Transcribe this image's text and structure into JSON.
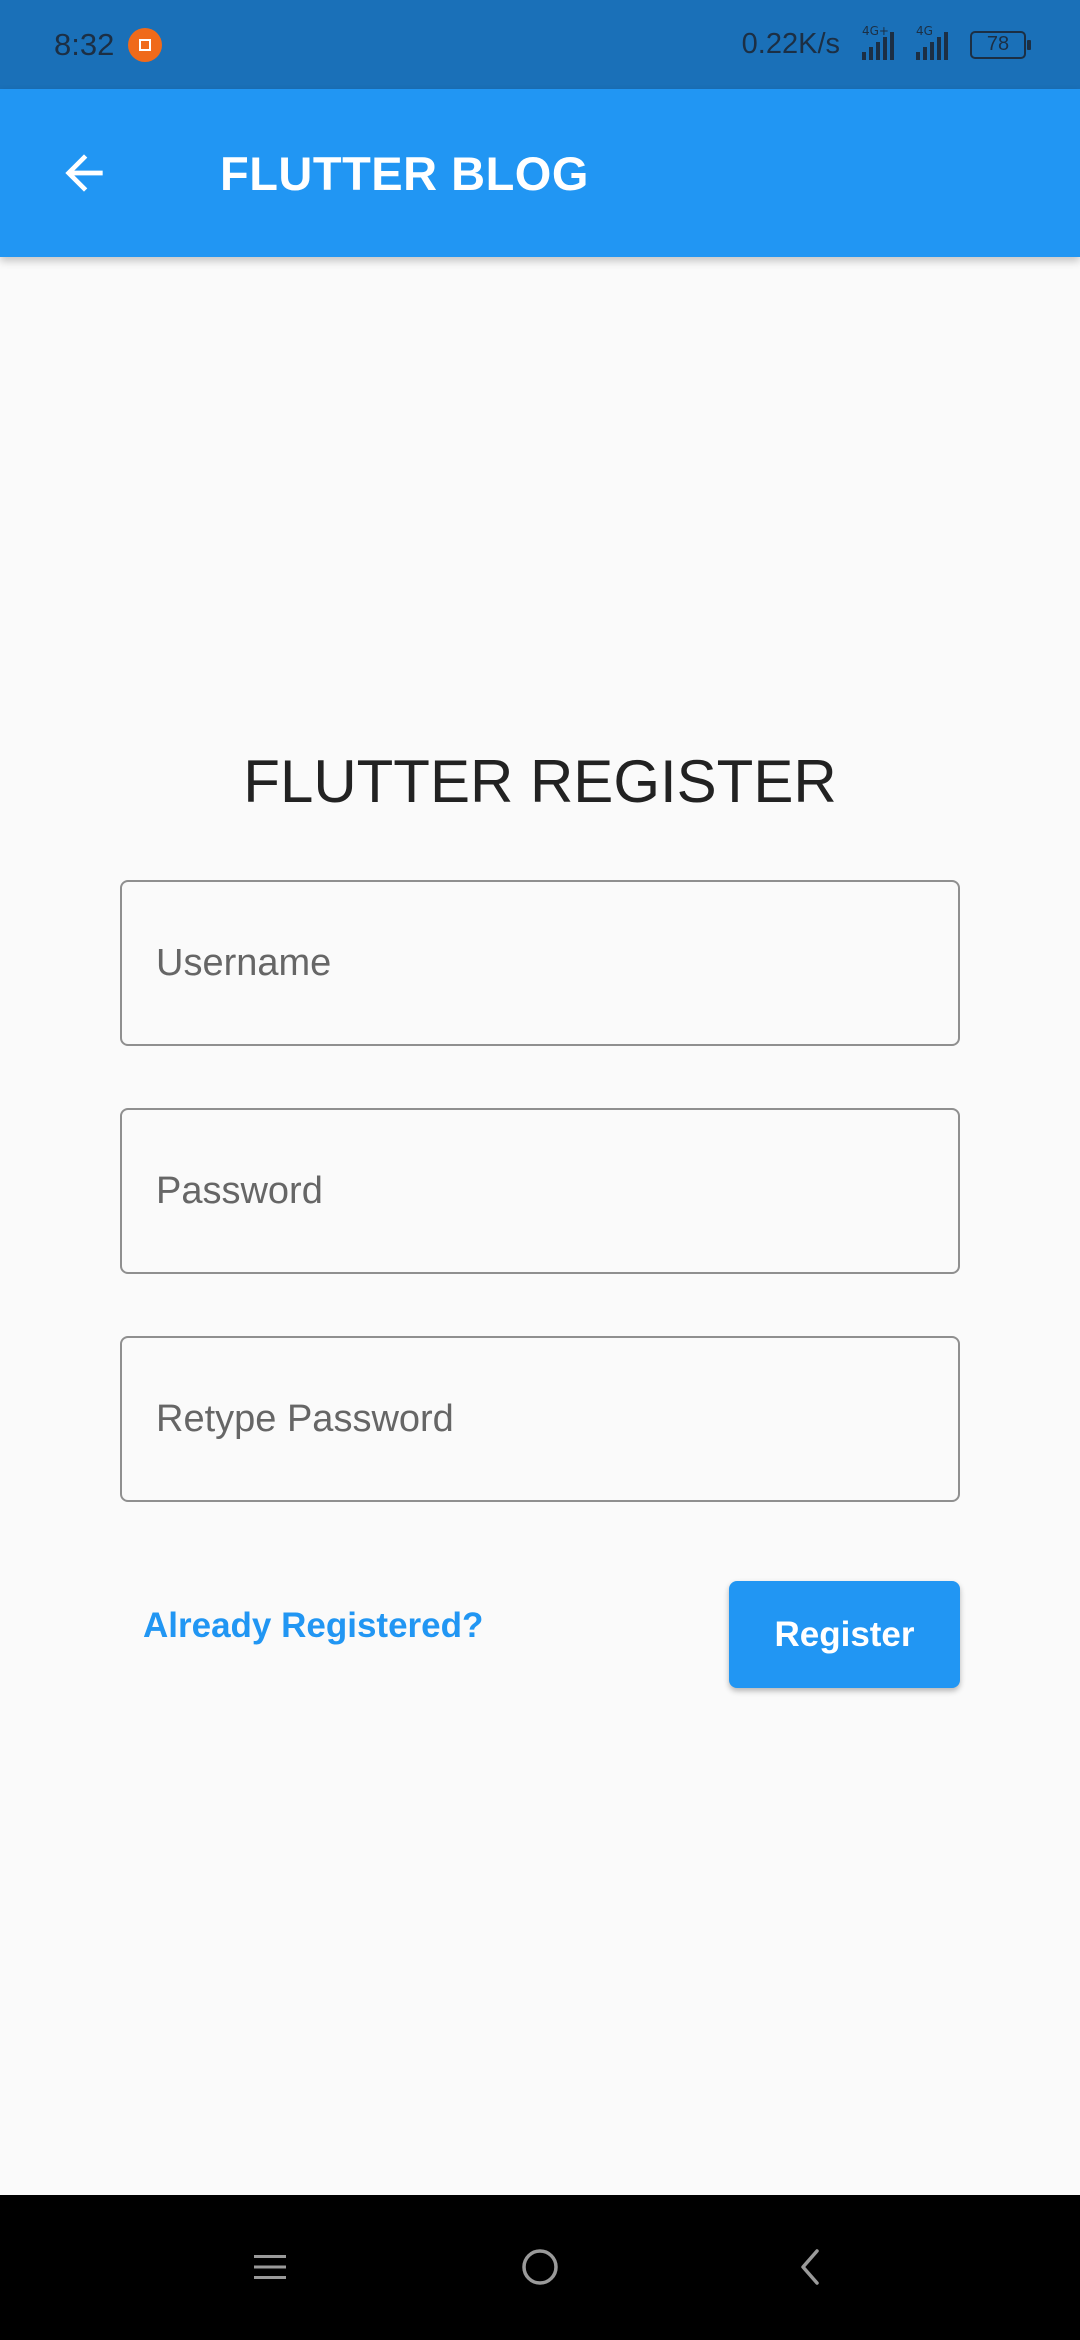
{
  "status_bar": {
    "time": "8:32",
    "net_speed": "0.22K/s",
    "signal1_tag": "4G+",
    "signal2_tag": "4G",
    "battery": "78"
  },
  "app_bar": {
    "title": "FLUTTER BLOG",
    "back_icon": "arrow-back-icon"
  },
  "form": {
    "title": "FLUTTER REGISTER",
    "username_placeholder": "Username",
    "password_placeholder": "Password",
    "retype_placeholder": "Retype Password",
    "already_registered_label": "Already Registered?",
    "register_label": "Register"
  },
  "nav_bar": {
    "menu_icon": "menu-icon",
    "home_icon": "home-circle-icon",
    "back_icon": "back-chevron-icon"
  },
  "colors": {
    "primary": "#2196f3",
    "status_bar": "#1a70b8",
    "background": "#fafafa"
  }
}
